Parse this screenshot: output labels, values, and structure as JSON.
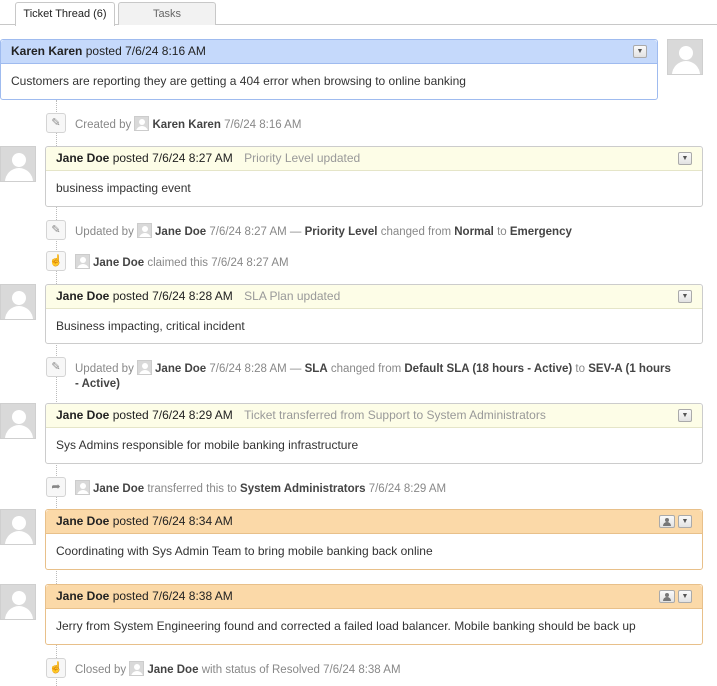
{
  "tabs": [
    {
      "label": "Ticket Thread (6)",
      "active": true
    },
    {
      "label": "Tasks",
      "active": false
    }
  ],
  "entries": [
    {
      "author": "Karen Karen",
      "posted": "posted",
      "time": "7/6/24 8:16 AM",
      "subtitle": "",
      "body": "Customers are reporting they are getting a 404 error when browsing to online banking",
      "color": "#c5d9fb"
    },
    {
      "author": "Jane Doe",
      "posted": "posted",
      "time": "7/6/24 8:27 AM",
      "subtitle": "Priority Level updated",
      "body": "business impacting event",
      "color": "#fdfde7"
    },
    {
      "author": "Jane Doe",
      "posted": "posted",
      "time": "7/6/24 8:28 AM",
      "subtitle": "SLA Plan updated",
      "body": "Business impacting, critical incident",
      "color": "#fdfde7"
    },
    {
      "author": "Jane Doe",
      "posted": "posted",
      "time": "7/6/24 8:29 AM",
      "subtitle": "Ticket transferred from Support to System Administrators",
      "body": "Sys Admins responsible for mobile banking infrastructure",
      "color": "#fdfde7"
    },
    {
      "author": "Jane Doe",
      "posted": "posted",
      "time": "7/6/24 8:34 AM",
      "subtitle": "",
      "body": "Coordinating with Sys Admin Team to bring mobile banking back online",
      "color": "#fbd9a8"
    },
    {
      "author": "Jane Doe",
      "posted": "posted",
      "time": "7/6/24 8:38 AM",
      "subtitle": "",
      "body": "Jerry from System Engineering found and corrected a failed load balancer. Mobile banking should be back up",
      "color": "#fbd9a8"
    }
  ],
  "events": {
    "created": {
      "prefix": "Created by",
      "user": "Karen Karen",
      "time": "7/6/24 8:16 AM"
    },
    "priority": {
      "prefix": "Updated by",
      "user": "Jane Doe",
      "time": "7/6/24 8:27 AM —",
      "field": "Priority Level",
      "changed_from": "changed from",
      "old": "Normal",
      "to": "to",
      "new": "Emergency"
    },
    "claimed": {
      "user": "Jane Doe",
      "action": "claimed this",
      "time": "7/6/24 8:27 AM"
    },
    "sla": {
      "prefix": "Updated by",
      "user": "Jane Doe",
      "time": "7/6/24 8:28 AM —",
      "field": "SLA",
      "changed_from": "changed from",
      "old": "Default SLA (18 hours - Active)",
      "to": "to",
      "new": "SEV-A (1 hours - Active)"
    },
    "transferred": {
      "user": "Jane Doe",
      "action": "transferred this to",
      "target": "System Administrators",
      "time": "7/6/24 8:29 AM"
    },
    "closed": {
      "prefix": "Closed by",
      "user": "Jane Doe",
      "status_text": "with status of Resolved",
      "time": "7/6/24 8:38 AM"
    }
  },
  "icons": {
    "dropdown": "caret-down-icon",
    "user": "user-icon",
    "edit": "pencil-icon",
    "claim": "thumbs-up-icon",
    "transfer": "share-arrow-icon"
  }
}
